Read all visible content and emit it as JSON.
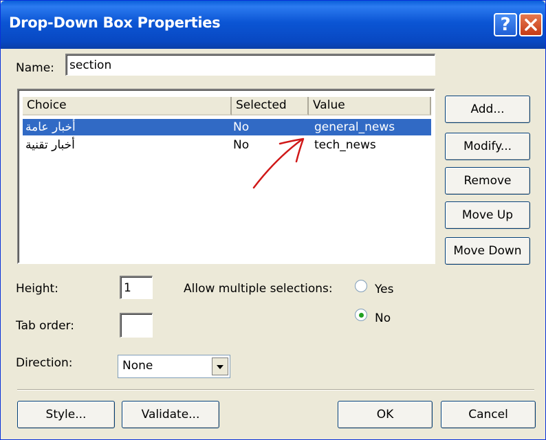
{
  "window": {
    "title": "Drop-Down Box Properties",
    "help_label": "?",
    "close_label": "X"
  },
  "name": {
    "label": "Name:",
    "value": "section"
  },
  "list": {
    "columns": [
      "Choice",
      "Selected",
      "Value"
    ],
    "rows": [
      {
        "choice": "أخبار عامة",
        "selected": "No",
        "value": "general_news",
        "highlighted": true
      },
      {
        "choice": "أخبار تقنية",
        "selected": "No",
        "value": "tech_news",
        "highlighted": false
      }
    ]
  },
  "side_buttons": {
    "add": "Add...",
    "modify": "Modify...",
    "remove": "Remove",
    "move_up": "Move Up",
    "move_down": "Move Down"
  },
  "height": {
    "label": "Height:",
    "value": "1"
  },
  "tab_order": {
    "label": "Tab order:",
    "value": ""
  },
  "multiple": {
    "label": "Allow multiple selections:",
    "yes_label": "Yes",
    "no_label": "No",
    "selected": "No"
  },
  "direction": {
    "label": "Direction:",
    "value": "None"
  },
  "footer": {
    "style": "Style...",
    "validate": "Validate...",
    "ok": "OK",
    "cancel": "Cancel"
  },
  "colors": {
    "title_bar": "#0a55d4",
    "selection": "#316ac5",
    "annotation_arrow": "#d01818"
  },
  "icons": {
    "help": "question-mark-icon",
    "close": "close-x-icon",
    "dropdown": "chevron-down-icon",
    "annotation": "red-arrow-annotation-icon"
  }
}
